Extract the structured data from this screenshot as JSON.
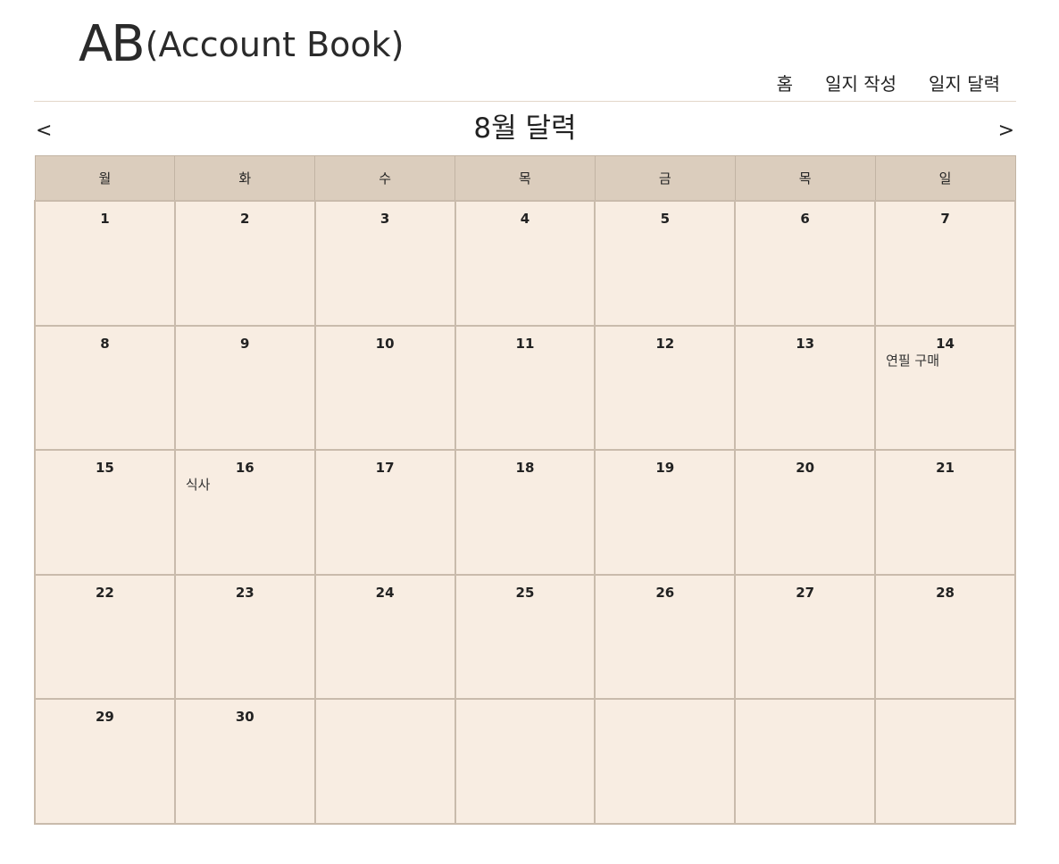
{
  "header": {
    "logo_main": "AB",
    "logo_sub": "(Account Book)"
  },
  "nav": {
    "items": [
      {
        "label": "홈"
      },
      {
        "label": "일지 작성"
      },
      {
        "label": "일지 달력"
      }
    ]
  },
  "calendar": {
    "title": "8월 달력",
    "prev_label": "<",
    "next_label": ">",
    "weekdays": [
      "월",
      "화",
      "수",
      "목",
      "금",
      "목",
      "일"
    ],
    "weeks": [
      [
        {
          "day": "1"
        },
        {
          "day": "2"
        },
        {
          "day": "3"
        },
        {
          "day": "4"
        },
        {
          "day": "5"
        },
        {
          "day": "6"
        },
        {
          "day": "7"
        }
      ],
      [
        {
          "day": "8"
        },
        {
          "day": "9"
        },
        {
          "day": "10"
        },
        {
          "day": "11"
        },
        {
          "day": "12"
        },
        {
          "day": "13"
        },
        {
          "day": "14",
          "events": [
            "연필 구매"
          ]
        }
      ],
      [
        {
          "day": "15"
        },
        {
          "day": "16",
          "events": [
            "식사"
          ]
        },
        {
          "day": "17"
        },
        {
          "day": "18"
        },
        {
          "day": "19"
        },
        {
          "day": "20"
        },
        {
          "day": "21"
        }
      ],
      [
        {
          "day": "22"
        },
        {
          "day": "23"
        },
        {
          "day": "24"
        },
        {
          "day": "25"
        },
        {
          "day": "26"
        },
        {
          "day": "27"
        },
        {
          "day": "28"
        }
      ],
      [
        {
          "day": "29"
        },
        {
          "day": "30"
        },
        {
          "day": ""
        },
        {
          "day": ""
        },
        {
          "day": ""
        },
        {
          "day": ""
        },
        {
          "day": ""
        }
      ]
    ]
  },
  "colors": {
    "header_cell_bg": "#dbcdbd",
    "day_cell_bg": "#f8ede2",
    "cell_border": "#c9bbac",
    "divider": "#e3d7c9"
  }
}
